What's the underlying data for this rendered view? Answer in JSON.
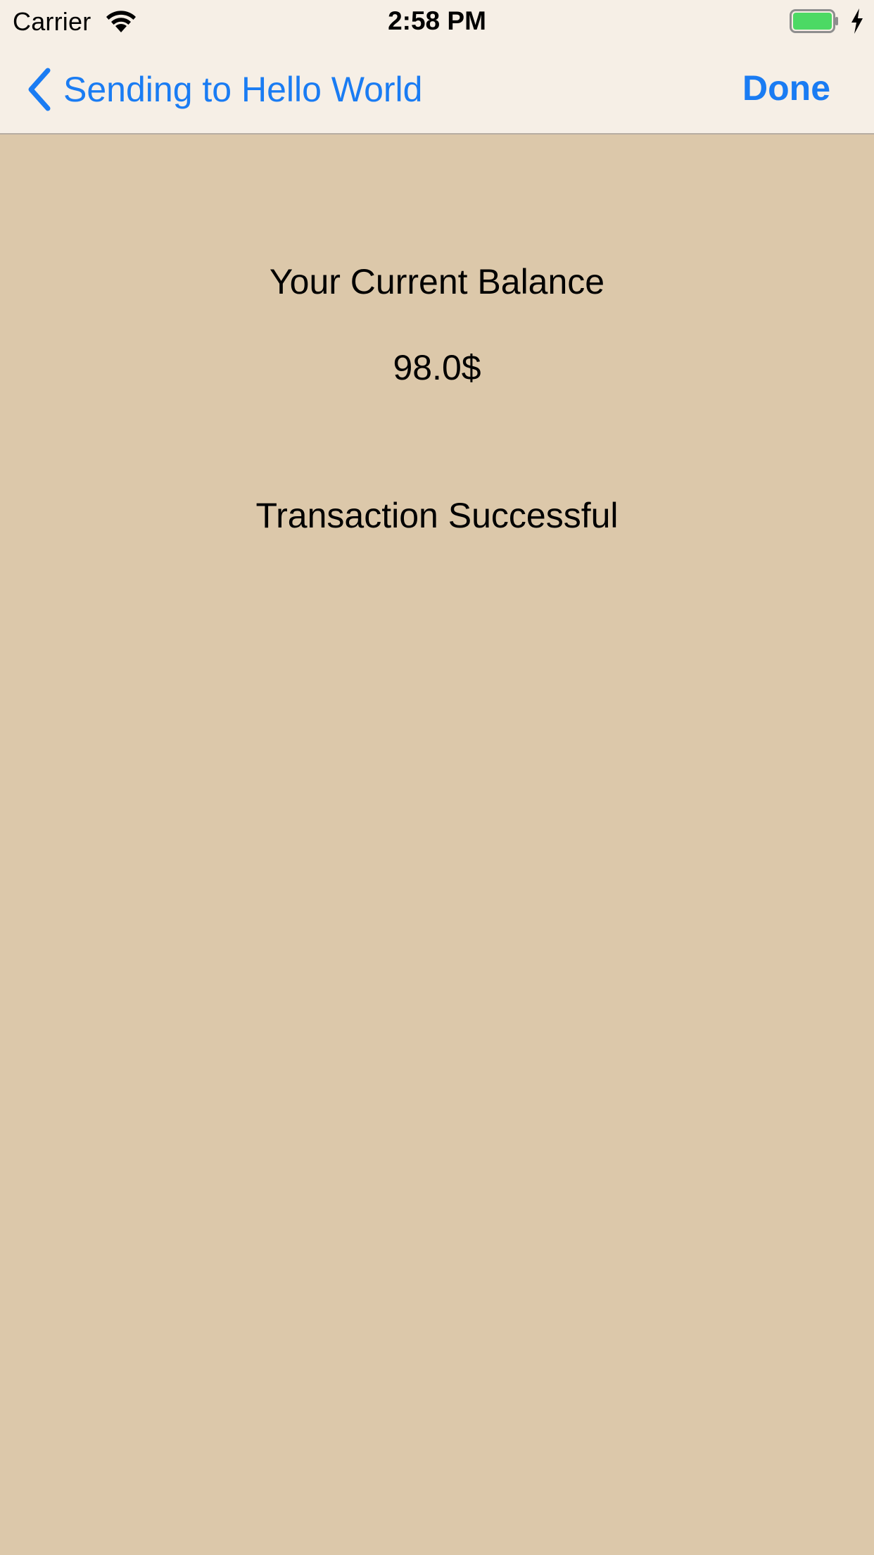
{
  "status_bar": {
    "carrier": "Carrier",
    "time": "2:58 PM",
    "wifi_icon": "wifi-icon",
    "battery_icon": "battery-icon",
    "charging_icon": "charging-bolt-icon",
    "battery_level": 1.0,
    "battery_color": "#4cd964"
  },
  "nav_bar": {
    "back_label": "Sending to Hello World",
    "back_icon": "chevron-left-icon",
    "done_label": "Done",
    "tint_color": "#1a7cf3",
    "background_color": "#f6efe6"
  },
  "main": {
    "balance_title": "Your Current Balance",
    "balance_amount": "98.0$",
    "transaction_status": "Transaction Successful",
    "background_color": "#dcc8aa"
  }
}
